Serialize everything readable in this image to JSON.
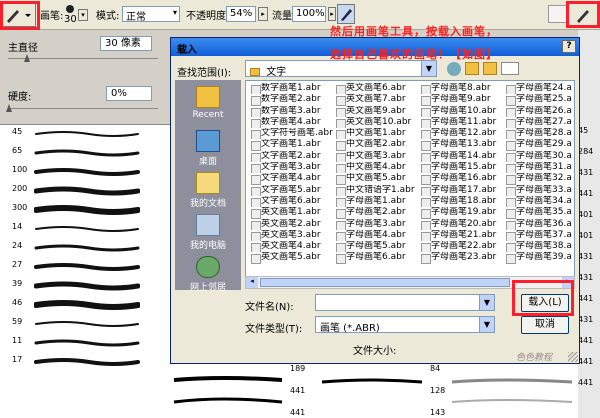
{
  "toolbar": {
    "brush_label": "画笔:",
    "brush_size": "30",
    "mode_label": "模式:",
    "mode_value": "正常",
    "opacity_label": "不透明度:",
    "opacity_value": "54%",
    "flow_label": "流量:",
    "flow_value": "100%"
  },
  "left_panel": {
    "diameter_label": "主直径",
    "diameter_value": "30 像素",
    "hardness_label": "硬度:",
    "hardness_value": "0%",
    "brush_numbers": [
      "45",
      "65",
      "100",
      "200",
      "300",
      "14",
      "24",
      "27",
      "39",
      "46",
      "59",
      "11",
      "17"
    ]
  },
  "right_panel": {
    "numbers": [
      "45",
      "284",
      "431",
      "441",
      "401",
      "401",
      "431",
      "431",
      "441",
      "431",
      "441",
      "441",
      "441"
    ]
  },
  "dialog": {
    "title": "载入",
    "look_in_label": "查找范围(I):",
    "look_in_value": "文字",
    "filename_label": "文件名(N):",
    "filetype_label": "文件类型(T):",
    "filetype_value": "画笔 (*.ABR)",
    "filesize_label": "文件大小:",
    "load_button": "载入(L)",
    "cancel_button": "取消",
    "places": [
      "Recent",
      "桌面",
      "我的文档",
      "我的电脑",
      "网上邻居"
    ],
    "columns": [
      [
        "数字画笔1.abr",
        "数字画笔2.abr",
        "数字画笔3.abr",
        "数字画笔4.abr",
        "文字符号画笔.abr",
        "文字画笔1.abr",
        "文字画笔2.abr",
        "文字画笔3.abr",
        "文字画笔4.abr",
        "文字画笔5.abr",
        "文字画笔6.abr",
        "英文画笔1.abr",
        "英文画笔2.abr",
        "英文画笔3.abr",
        "英文画笔4.abr",
        "英文画笔5.abr"
      ],
      [
        "英文画笔6.abr",
        "英文画笔7.abr",
        "英文画笔9.abr",
        "英文画笔10.abr",
        "中文画笔1.abr",
        "中文画笔2.abr",
        "中文画笔3.abr",
        "中文画笔4.abr",
        "中文画笔5.abr",
        "中文错语字1.abr",
        "字母画笔1.abr",
        "字母画笔2.abr",
        "字母画笔3.abr",
        "字母画笔4.abr",
        "字母画笔5.abr",
        "字母画笔6.abr"
      ],
      [
        "字母画笔8.abr",
        "字母画笔9.abr",
        "字母画笔10.abr",
        "字母画笔11.abr",
        "字母画笔12.abr",
        "字母画笔13.abr",
        "字母画笔14.abr",
        "字母画笔15.abr",
        "字母画笔16.abr",
        "字母画笔17.abr",
        "字母画笔18.abr",
        "字母画笔19.abr",
        "字母画笔20.abr",
        "字母画笔21.abr",
        "字母画笔22.abr",
        "字母画笔23.abr"
      ],
      [
        "字母画笔24.a",
        "字母画笔25.a",
        "字母画笔26.a",
        "字母画笔27.a",
        "字母画笔28.a",
        "字母画笔29.a",
        "字母画笔30.a",
        "字母画笔31.a",
        "字母画笔32.a",
        "字母画笔33.a",
        "字母画笔34.a",
        "字母画笔35.a",
        "字母画笔36.a",
        "字母画笔37.a",
        "字母画笔38.a",
        "字母画笔39.a"
      ]
    ]
  },
  "annotation": {
    "line1": "然后用画笔工具，按载入画笔，",
    "line2": "选择自己喜欢的画笔！【如图】"
  },
  "bottom_strip": {
    "numbers": [
      "189",
      "441",
      "441",
      "84",
      "128",
      "143"
    ]
  },
  "watermark": "色色教程",
  "colors": {
    "highlight_red": "#ff1e2a",
    "annotation_red": "#ff2020",
    "title_blue": "#0e5ed8"
  }
}
